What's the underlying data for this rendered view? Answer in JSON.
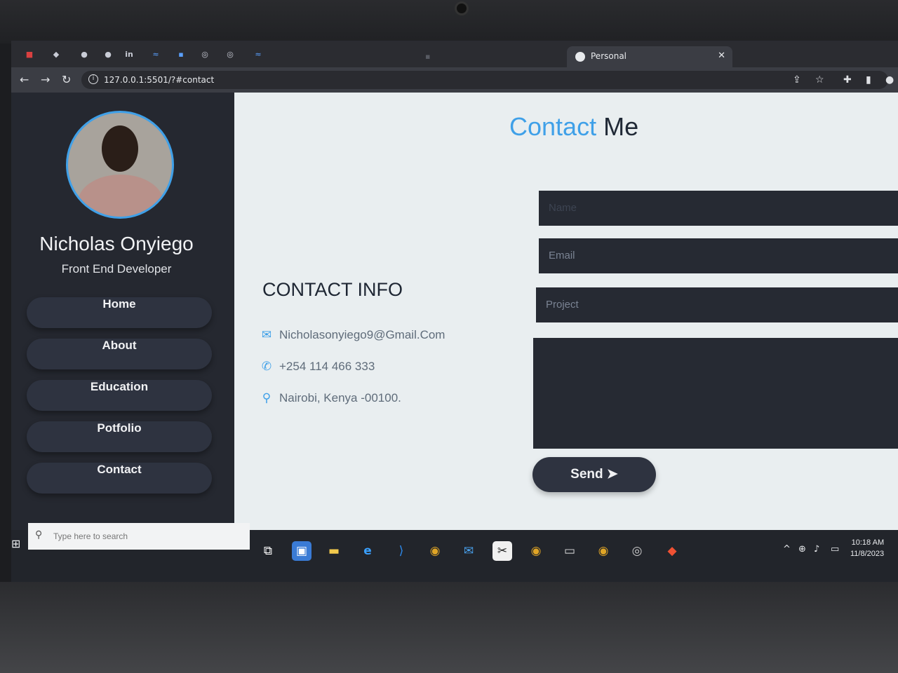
{
  "browser": {
    "active_tab_title": "Personal",
    "url": "127.0.0.1:5501/?#contact"
  },
  "profile": {
    "name": "Nicholas Onyiego",
    "role": "Front End Developer"
  },
  "nav": {
    "items": [
      "Home",
      "About",
      "Education",
      "Potfolio",
      "Contact"
    ]
  },
  "heading": {
    "accent": "Contact",
    "rest": "Me"
  },
  "contact_info": {
    "title": "CONTACT INFO",
    "email": "Nicholasonyiego9@Gmail.Com",
    "phone": "+254 114 466 333",
    "location": "Nairobi, Kenya -00100."
  },
  "form": {
    "name_placeholder": "Name",
    "email_placeholder": "Email",
    "project_placeholder": "Project",
    "send_label": "Send"
  },
  "taskbar": {
    "search_placeholder": "Type here to search",
    "time": "10:18 AM",
    "date": "11/8/2023"
  },
  "colors": {
    "accent": "#3fa0e8",
    "sidebar": "#252830",
    "field": "#262a33"
  },
  "icons": [
    "envelope-icon",
    "phone-icon",
    "location-pin-icon",
    "paper-plane-icon"
  ]
}
